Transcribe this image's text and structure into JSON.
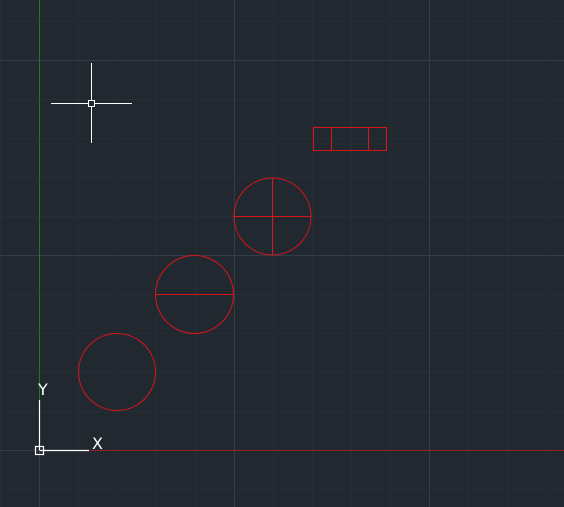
{
  "app": {
    "view": "model-space-drawing-area"
  },
  "colors": {
    "background": "#212830",
    "grid_minor": "#262d37",
    "grid_major": "#343c48",
    "axis_x": "#8f2222",
    "axis_y": "#1f7a1f",
    "entity": "#d9161a",
    "ucs": "#ffffff",
    "crosshair": "#ffffff"
  },
  "ucs_icon": {
    "x_label": "X",
    "y_label": "Y",
    "icon": "ucs-axis-icon"
  },
  "crosshair": {
    "icon": "crosshair-cursor-icon"
  },
  "entities": [
    {
      "type": "circle",
      "variant": "plain"
    },
    {
      "type": "circle",
      "variant": "horizontal-bisector"
    },
    {
      "type": "circle",
      "variant": "quartered"
    },
    {
      "type": "rectangle",
      "variant": "three-cell"
    }
  ]
}
